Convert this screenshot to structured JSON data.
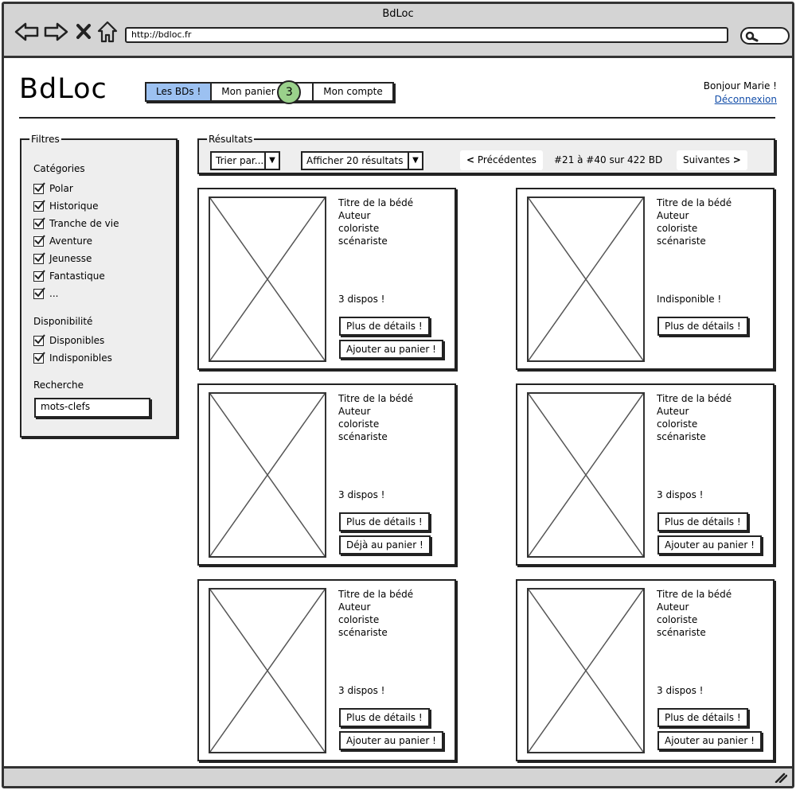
{
  "window": {
    "title": "BdLoc",
    "url": "http://bdloc.fr"
  },
  "header": {
    "logo": "BdLoc",
    "tabs": [
      {
        "label": "Les BDs !",
        "active": true
      },
      {
        "label": "Mon panier",
        "badge": "3"
      },
      {
        "label": "Mon compte"
      }
    ],
    "greeting": "Bonjour Marie !",
    "logout": "Déconnexion"
  },
  "filters": {
    "legend": "Filtres",
    "categories_title": "Catégories",
    "categories": [
      "Polar",
      "Historique",
      "Tranche de vie",
      "Aventure",
      "Jeunesse",
      "Fantastique",
      "..."
    ],
    "availability_title": "Disponibilité",
    "availability": [
      "Disponibles",
      "Indisponibles"
    ],
    "search_title": "Recherche",
    "search_value": "mots-clefs"
  },
  "results": {
    "legend": "Résultats",
    "sort": "Trier par...",
    "per_page": "Afficher 20 résultats",
    "prev": "Précédentes",
    "range": "#21 à #40 sur 422 BD",
    "next": "Suivantes"
  },
  "cards": [
    {
      "title": "Titre de la bédé",
      "author": "Auteur",
      "colorist": "coloriste",
      "writer": "scénariste",
      "status": "3 dispos !",
      "details": "Plus de détails !",
      "cart": "Ajouter au panier !"
    },
    {
      "title": "Titre de la bédé",
      "author": "Auteur",
      "colorist": "coloriste",
      "writer": "scénariste",
      "status": "Indisponible !",
      "details": "Plus de détails !",
      "cart": ""
    },
    {
      "title": "Titre de la bédé",
      "author": "Auteur",
      "colorist": "coloriste",
      "writer": "scénariste",
      "status": "3 dispos !",
      "details": "Plus de détails !",
      "cart": "Déjà au panier !"
    },
    {
      "title": "Titre de la bédé",
      "author": "Auteur",
      "colorist": "coloriste",
      "writer": "scénariste",
      "status": "3 dispos !",
      "details": "Plus de détails !",
      "cart": "Ajouter au panier !"
    },
    {
      "title": "Titre de la bédé",
      "author": "Auteur",
      "colorist": "coloriste",
      "writer": "scénariste",
      "status": "3 dispos !",
      "details": "Plus de détails !",
      "cart": "Ajouter au panier !"
    },
    {
      "title": "Titre de la bédé",
      "author": "Auteur",
      "colorist": "coloriste",
      "writer": "scénariste",
      "status": "3 dispos !",
      "details": "Plus de détails !",
      "cart": "Ajouter au panier !"
    }
  ],
  "colors": {
    "active_tab": "#9cc1f1",
    "badge": "#9ad18b",
    "link": "#124da8",
    "chrome": "#d4d4d4",
    "panel": "#eeeeee"
  }
}
